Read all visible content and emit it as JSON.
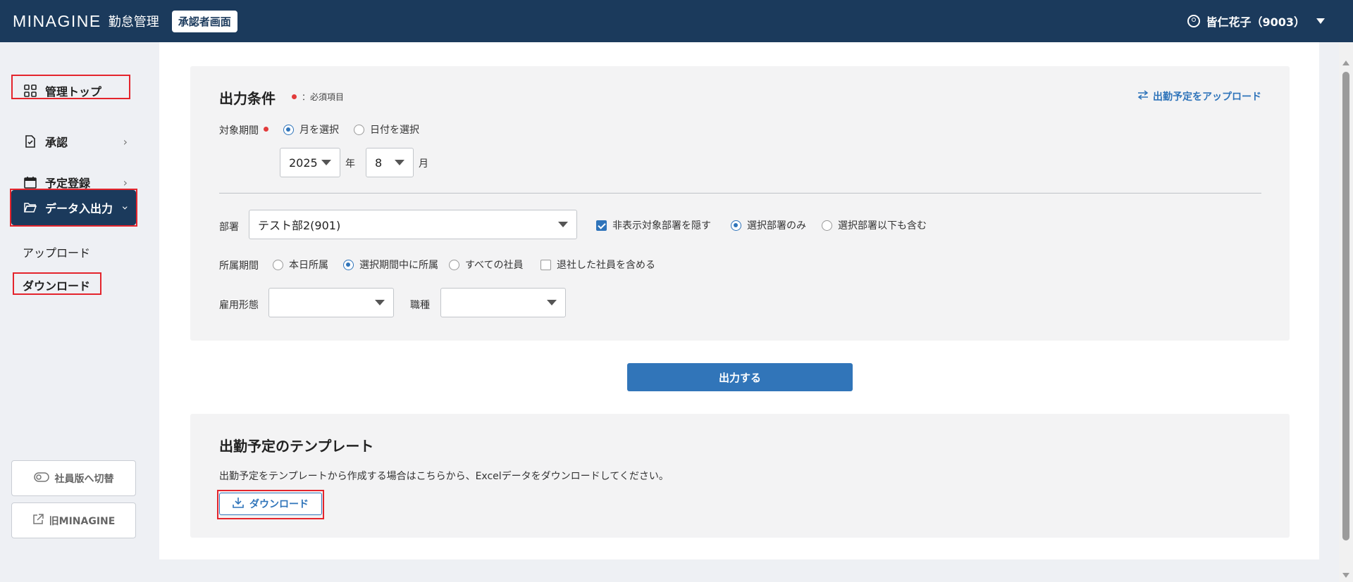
{
  "header": {
    "brand": "MINAGINE",
    "brand_sub": "勤怠管理",
    "role_badge": "承認者画面",
    "user": "皆仁花子（9003）"
  },
  "sidebar": {
    "items": [
      {
        "label": "管理トップ"
      },
      {
        "label": "承認"
      },
      {
        "label": "予定登録"
      },
      {
        "label": "データ入出力"
      }
    ],
    "subitems": [
      {
        "label": "アップロード"
      },
      {
        "label": "ダウンロード"
      }
    ],
    "switch_button": "社員版へ切替",
    "legacy_button": "旧MINAGINE"
  },
  "conditions": {
    "title": "出力条件",
    "required_note": "：必須項目",
    "upload_link": "出勤予定をアップロード",
    "period_label": "対象期間",
    "period_options": [
      {
        "label": "月を選択",
        "selected": true
      },
      {
        "label": "日付を選択",
        "selected": false
      }
    ],
    "year_value": "2025",
    "year_unit": "年",
    "month_value": "8",
    "month_unit": "月",
    "dept_label": "部署",
    "dept_value": "テスト部2(901)",
    "hide_dept_label": "非表示対象部署を隠す",
    "hide_dept_checked": true,
    "dept_scope_options": [
      {
        "label": "選択部署のみ",
        "selected": true
      },
      {
        "label": "選択部署以下も含む",
        "selected": false
      }
    ],
    "affiliation_label": "所属期間",
    "affiliation_options": [
      {
        "label": "本日所属",
        "selected": false
      },
      {
        "label": "選択期間中に所属",
        "selected": true
      },
      {
        "label": "すべての社員",
        "selected": false
      }
    ],
    "retired_label": "退社した社員を含める",
    "retired_checked": false,
    "employment_label": "雇用形態",
    "employment_value": "",
    "job_label": "職種",
    "job_value": ""
  },
  "output_button": "出力する",
  "template": {
    "title": "出勤予定のテンプレート",
    "description": "出勤予定をテンプレートから作成する場合はこちらから、Excelデータをダウンロードしてください。",
    "download_button": "ダウンロード"
  },
  "colors": {
    "header_bg": "#1b3a5c",
    "accent": "#3175b9",
    "highlight": "#e4242c"
  }
}
